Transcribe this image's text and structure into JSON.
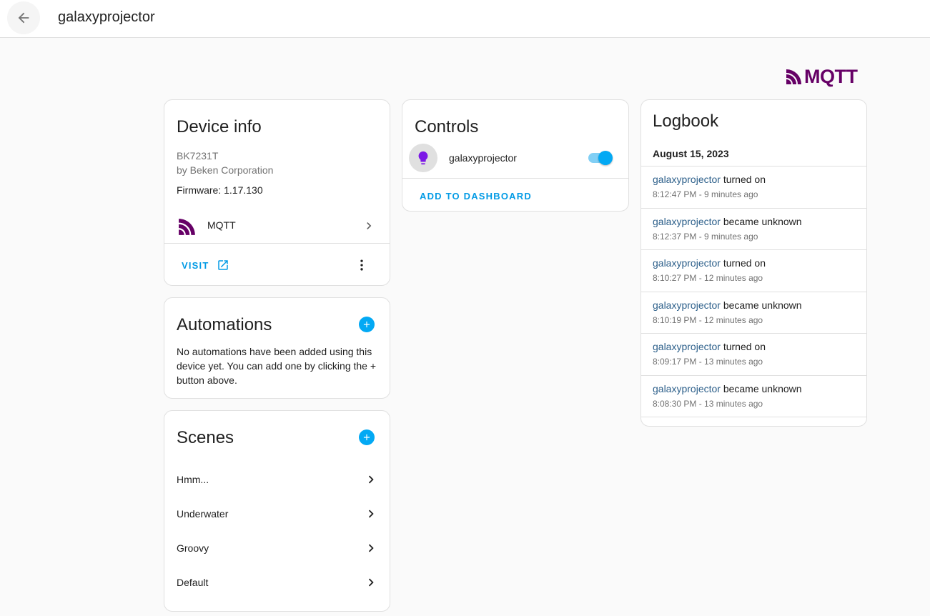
{
  "header": {
    "title": "galaxyprojector"
  },
  "brand": {
    "logo_text": "MQTT",
    "color": "#660066"
  },
  "device_info": {
    "title": "Device info",
    "model": "BK7231T",
    "manufacturer": "by Beken Corporation",
    "firmware": "Firmware: 1.17.130",
    "integration": "MQTT",
    "visit_label": "VISIT"
  },
  "automations": {
    "title": "Automations",
    "empty_text": "No automations have been added using this device yet. You can add one by clicking the + button above."
  },
  "scenes": {
    "title": "Scenes",
    "items": [
      "Hmm...",
      "Underwater",
      "Groovy",
      "Default"
    ]
  },
  "controls": {
    "title": "Controls",
    "entity_name": "galaxyprojector",
    "toggle_state": "on",
    "add_to_dashboard": "ADD TO DASHBOARD"
  },
  "logbook": {
    "title": "Logbook",
    "date": "August 15, 2023",
    "entries": [
      {
        "entity": "galaxyprojector",
        "action": "turned on",
        "time": "8:12:47 PM - 9 minutes ago"
      },
      {
        "entity": "galaxyprojector",
        "action": "became unknown",
        "time": "8:12:37 PM - 9 minutes ago"
      },
      {
        "entity": "galaxyprojector",
        "action": "turned on",
        "time": "8:10:27 PM - 12 minutes ago"
      },
      {
        "entity": "galaxyprojector",
        "action": "became unknown",
        "time": "8:10:19 PM - 12 minutes ago"
      },
      {
        "entity": "galaxyprojector",
        "action": "turned on",
        "time": "8:09:17 PM - 13 minutes ago"
      },
      {
        "entity": "galaxyprojector",
        "action": "became unknown",
        "time": "8:08:30 PM - 13 minutes ago"
      }
    ]
  },
  "colors": {
    "accent": "#03a9f4",
    "bulb": "#7c18e6",
    "link": "#2c5f8a"
  }
}
